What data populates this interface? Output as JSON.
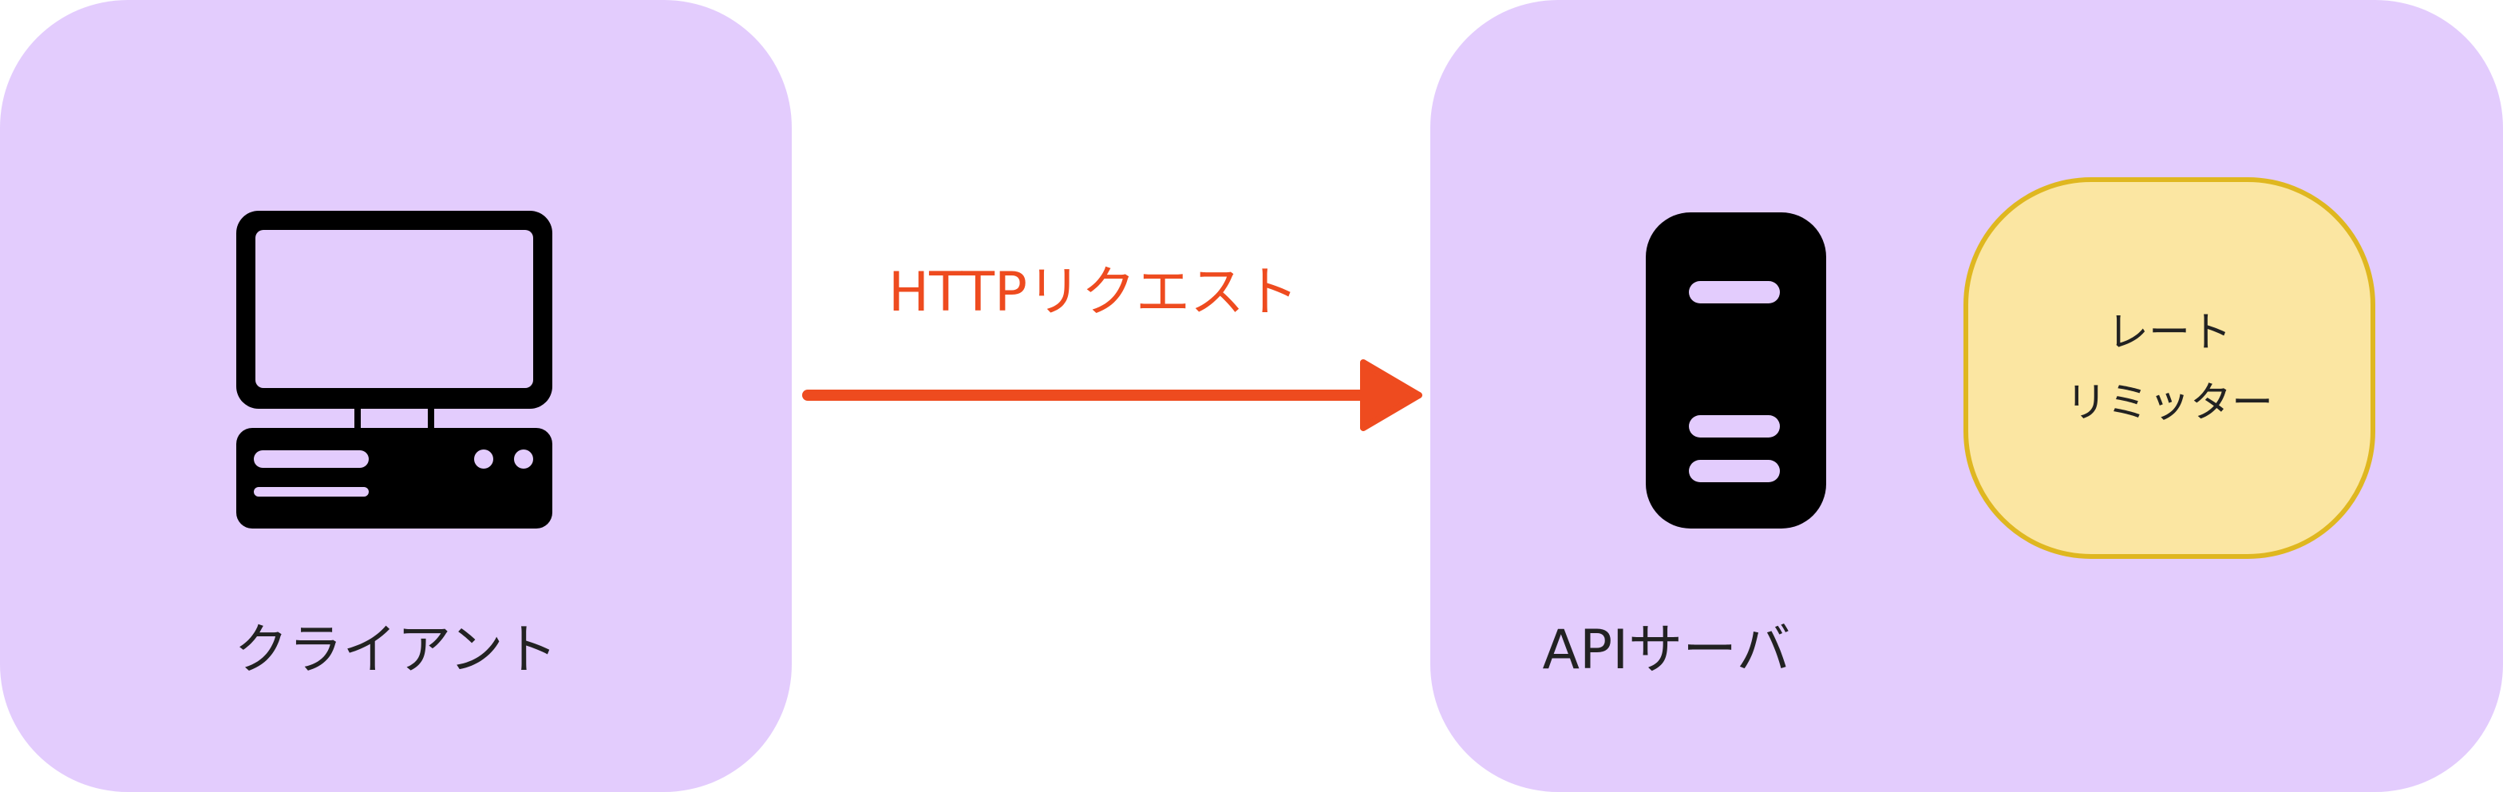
{
  "client": {
    "label": "クライアント"
  },
  "server": {
    "label": "APIサーバ"
  },
  "rate_limiter": {
    "line1": "レート",
    "line2": "リミッター"
  },
  "request": {
    "label": "HTTPリクエスト"
  },
  "colors": {
    "panel": "#e3ccfd",
    "arrow": "#ee4b1f",
    "rate_limiter_fill": "#fbe6a2",
    "rate_limiter_border": "#dfb720",
    "icon": "#000000"
  },
  "icons": {
    "client": "desktop-computer-icon",
    "server": "server-icon"
  }
}
